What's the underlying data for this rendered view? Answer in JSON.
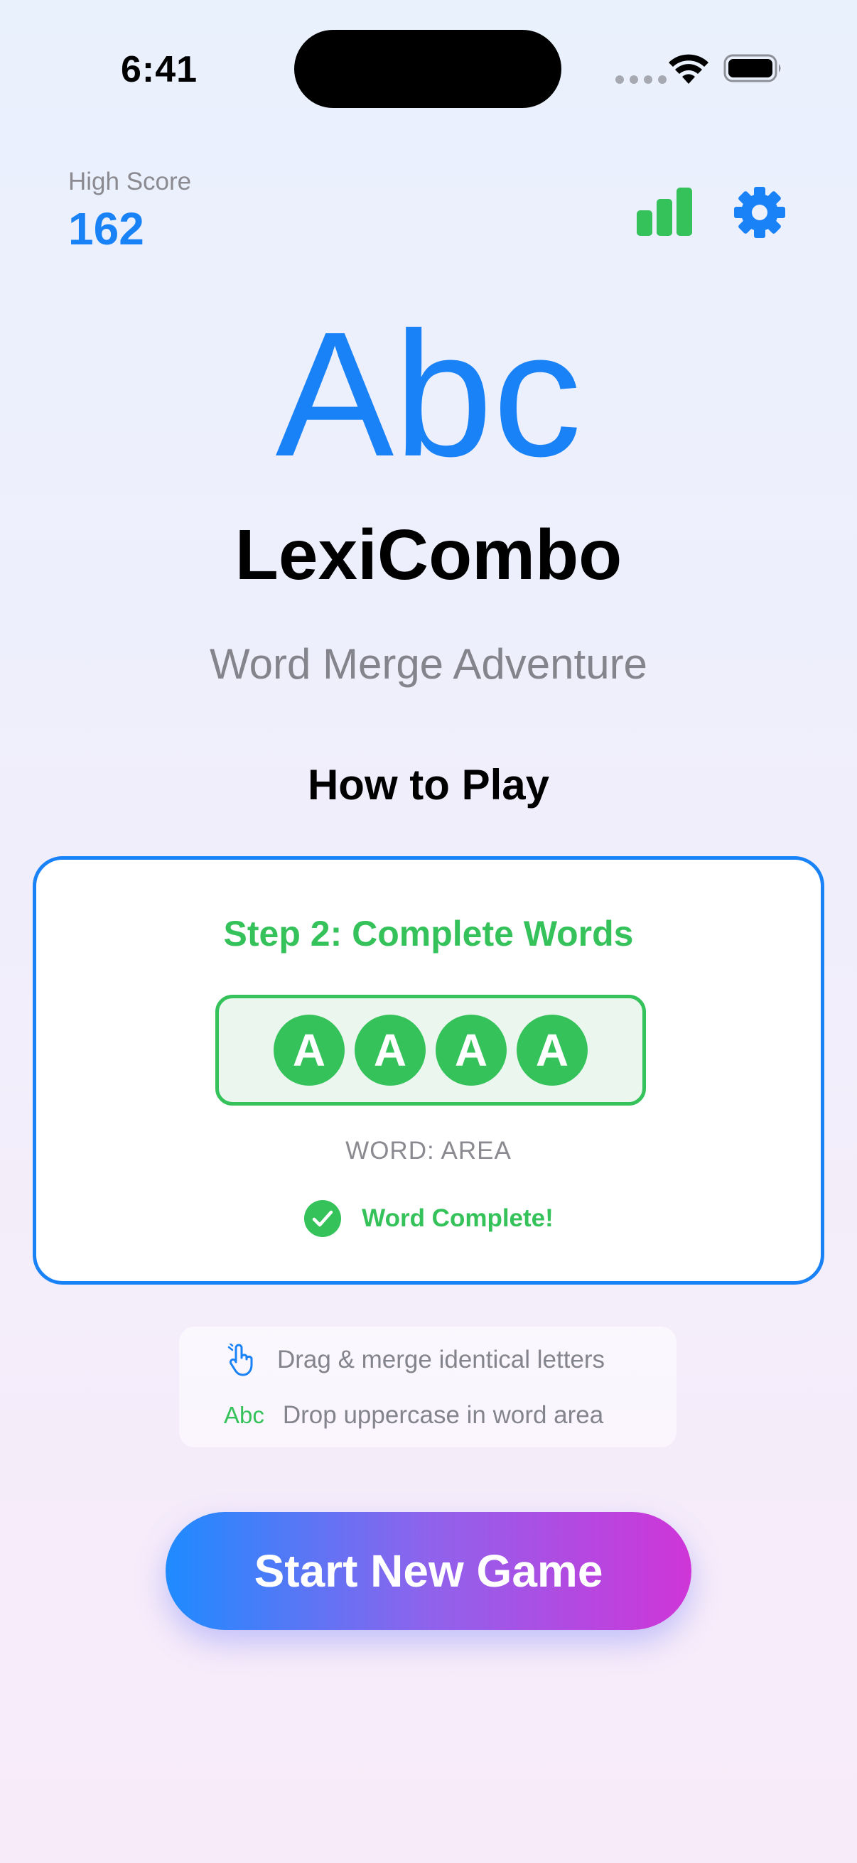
{
  "status_bar": {
    "time": "6:41"
  },
  "header": {
    "high_score_label": "High Score",
    "high_score_value": "162",
    "stats_icon": "bar-chart-icon",
    "settings_icon": "gear-icon"
  },
  "hero": {
    "icon_text": "Abc",
    "title": "LexiCombo",
    "subtitle": "Word Merge Adventure"
  },
  "how_to_play": {
    "title": "How to Play",
    "step_title": "Step 2: Complete Words",
    "letters": [
      "A",
      "A",
      "A",
      "A"
    ],
    "word_label": "WORD: AREA",
    "complete_text": "Word Complete!"
  },
  "tips": {
    "tip1": "Drag & merge identical letters",
    "tip2_icon_text": "Abc",
    "tip2": "Drop uppercase in word area"
  },
  "cta": {
    "start_label": "Start New Game"
  },
  "colors": {
    "accent_blue": "#1a82f7",
    "success_green": "#35c25a",
    "gradient_start": "#1e8bff",
    "gradient_end": "#cf35d8"
  }
}
